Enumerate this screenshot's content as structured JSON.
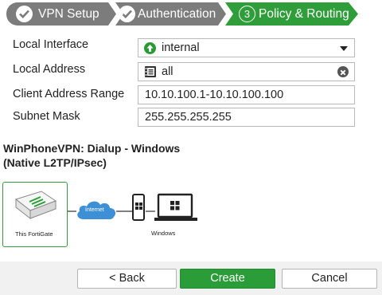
{
  "wizard": {
    "steps": [
      {
        "label": "VPN Setup",
        "state": "done"
      },
      {
        "label": "Authentication",
        "state": "done"
      },
      {
        "label": "Policy & Routing",
        "state": "active",
        "number": "3"
      }
    ]
  },
  "form": {
    "local_interface": {
      "label": "Local Interface",
      "value": "internal",
      "icon": "arrow-up-circle-icon"
    },
    "local_address": {
      "label": "Local Address",
      "value": "all",
      "icon": "address-book-icon"
    },
    "client_address_range": {
      "label": "Client Address Range",
      "value": "10.10.100.1-10.10.100.100"
    },
    "subnet_mask": {
      "label": "Subnet Mask",
      "value": "255.255.255.255"
    }
  },
  "topology": {
    "title_line1": "WinPhoneVPN: Dialup - Windows",
    "title_line2": "(Native L2TP/IPsec)",
    "fortigate_label": "This FortiGate",
    "cloud_label": "Internet",
    "client_label": "Windows"
  },
  "footer": {
    "back_label": "< Back",
    "create_label": "Create",
    "cancel_label": "Cancel"
  },
  "colors": {
    "accent_green": "#2f9e3a",
    "done_step_gray": "#7c7c7c",
    "cloud_blue": "#3d8fd6"
  }
}
